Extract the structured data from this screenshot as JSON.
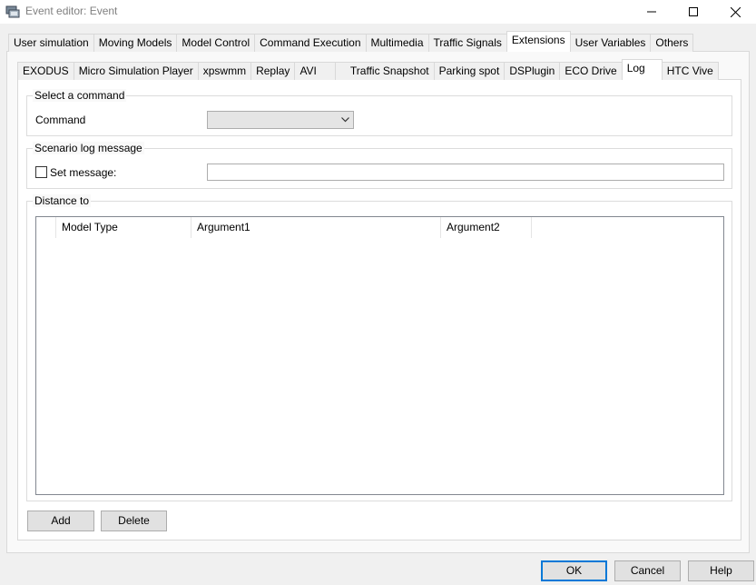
{
  "window": {
    "title": "Event editor: Event",
    "icons": [
      "app-icon",
      "minimize-icon",
      "maximize-icon",
      "close-icon"
    ]
  },
  "tabs_top": [
    {
      "label": "User simulation",
      "active": false
    },
    {
      "label": "Moving Models",
      "active": false
    },
    {
      "label": "Model Control",
      "active": false
    },
    {
      "label": "Command Execution",
      "active": false
    },
    {
      "label": "Multimedia",
      "active": false
    },
    {
      "label": "Traffic Signals",
      "active": false
    },
    {
      "label": "Extensions",
      "active": true
    },
    {
      "label": "User Variables",
      "active": false
    },
    {
      "label": "Others",
      "active": false
    }
  ],
  "tabs_sub": [
    {
      "label": "EXODUS",
      "active": false
    },
    {
      "label": "Micro Simulation Player",
      "active": false
    },
    {
      "label": "xpswmm",
      "active": false
    },
    {
      "label": "Replay",
      "active": false
    },
    {
      "label": "AVI",
      "active": false
    },
    {
      "label": "Traffic Snapshot",
      "active": false
    },
    {
      "label": "Parking spot",
      "active": false
    },
    {
      "label": "DSPlugin",
      "active": false
    },
    {
      "label": "ECO Drive",
      "active": false
    },
    {
      "label": "Log",
      "active": true
    },
    {
      "label": "HTC Vive",
      "active": false
    }
  ],
  "select_command": {
    "group_label": "Select a command",
    "field_label": "Command",
    "value": ""
  },
  "scenario_log": {
    "group_label": "Scenario log message",
    "checkbox_label": "Set message:",
    "checked": false,
    "message": ""
  },
  "distance_to": {
    "group_label": "Distance to",
    "columns": [
      "Model Type",
      "Argument1",
      "Argument2"
    ],
    "rows": []
  },
  "actions": {
    "add": "Add",
    "delete": "Delete"
  },
  "footer": {
    "ok": "OK",
    "cancel": "Cancel",
    "help": "Help"
  },
  "colors": {
    "accent": "#0078d7",
    "window_bg": "#f0f0f0",
    "panel_bg": "#ffffff"
  }
}
